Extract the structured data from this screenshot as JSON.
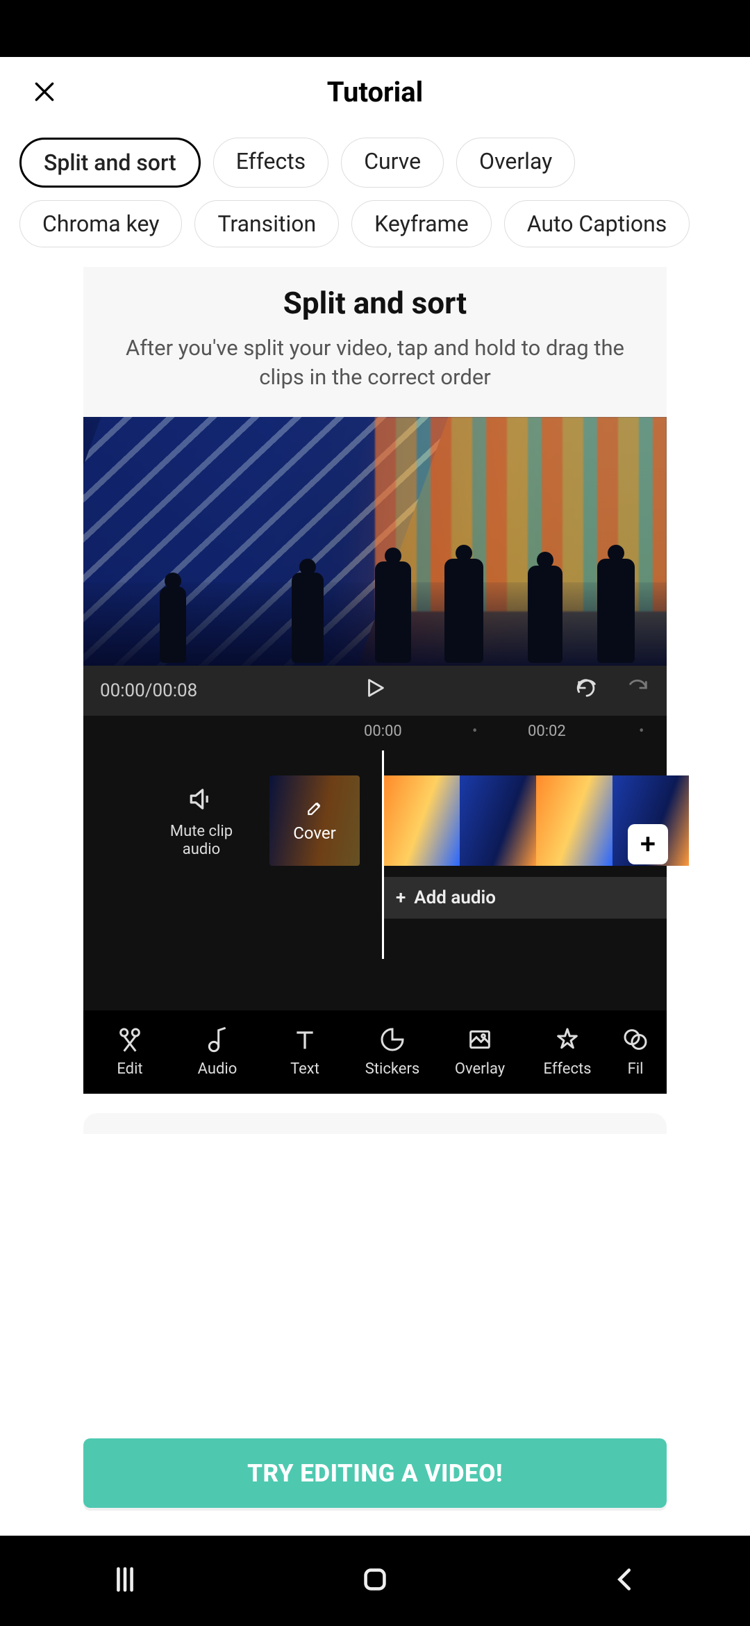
{
  "header": {
    "title": "Tutorial"
  },
  "chips": [
    {
      "label": "Split and sort",
      "selected": true
    },
    {
      "label": "Effects",
      "selected": false
    },
    {
      "label": "Curve",
      "selected": false
    },
    {
      "label": "Overlay",
      "selected": false
    },
    {
      "label": "Chroma key",
      "selected": false
    },
    {
      "label": "Transition",
      "selected": false
    },
    {
      "label": "Keyframe",
      "selected": false
    },
    {
      "label": "Auto Captions",
      "selected": false
    }
  ],
  "card": {
    "title": "Split and sort",
    "description": "After you've split your video, tap and hold to drag the clips in the correct order"
  },
  "editor": {
    "time_label": "00:00/00:08",
    "ruler": {
      "t0": "00:00",
      "t1": "00:02"
    },
    "mute_label_line1": "Mute clip",
    "mute_label_line2": "audio",
    "cover_label": "Cover",
    "add_audio_label": "Add audio",
    "tools": [
      {
        "name": "edit",
        "label": "Edit"
      },
      {
        "name": "audio",
        "label": "Audio"
      },
      {
        "name": "text",
        "label": "Text"
      },
      {
        "name": "stickers",
        "label": "Stickers"
      },
      {
        "name": "overlay",
        "label": "Overlay"
      },
      {
        "name": "effects",
        "label": "Effects"
      },
      {
        "name": "filters",
        "label": "Fil"
      }
    ]
  },
  "cta": {
    "label": "TRY EDITING A VIDEO!"
  },
  "colors": {
    "accent": "#4ec9b0"
  }
}
